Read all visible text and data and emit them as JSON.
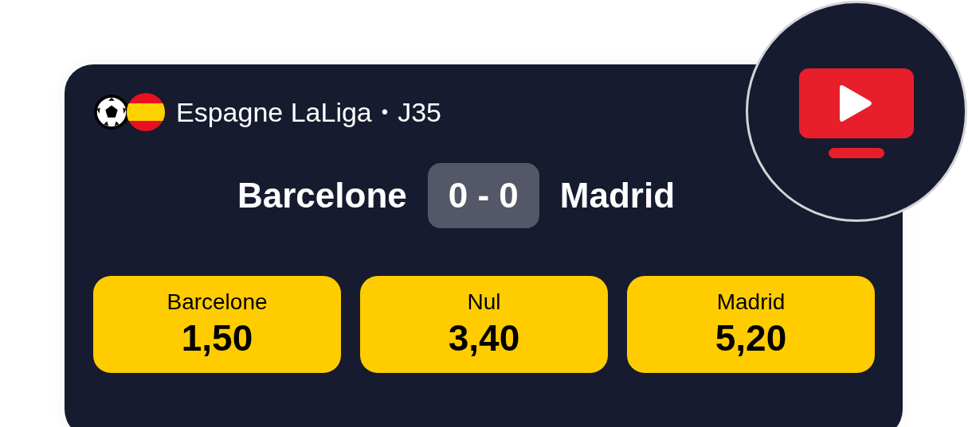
{
  "league": {
    "name": "Espagne LaLiga",
    "separator": "•",
    "round": "J35"
  },
  "match": {
    "home": "Barcelone",
    "score": "0 - 0",
    "away": "Madrid"
  },
  "odds": [
    {
      "label": "Barcelone",
      "value": "1,50"
    },
    {
      "label": "Nul",
      "value": "3,40"
    },
    {
      "label": "Madrid",
      "value": "5,20"
    }
  ]
}
